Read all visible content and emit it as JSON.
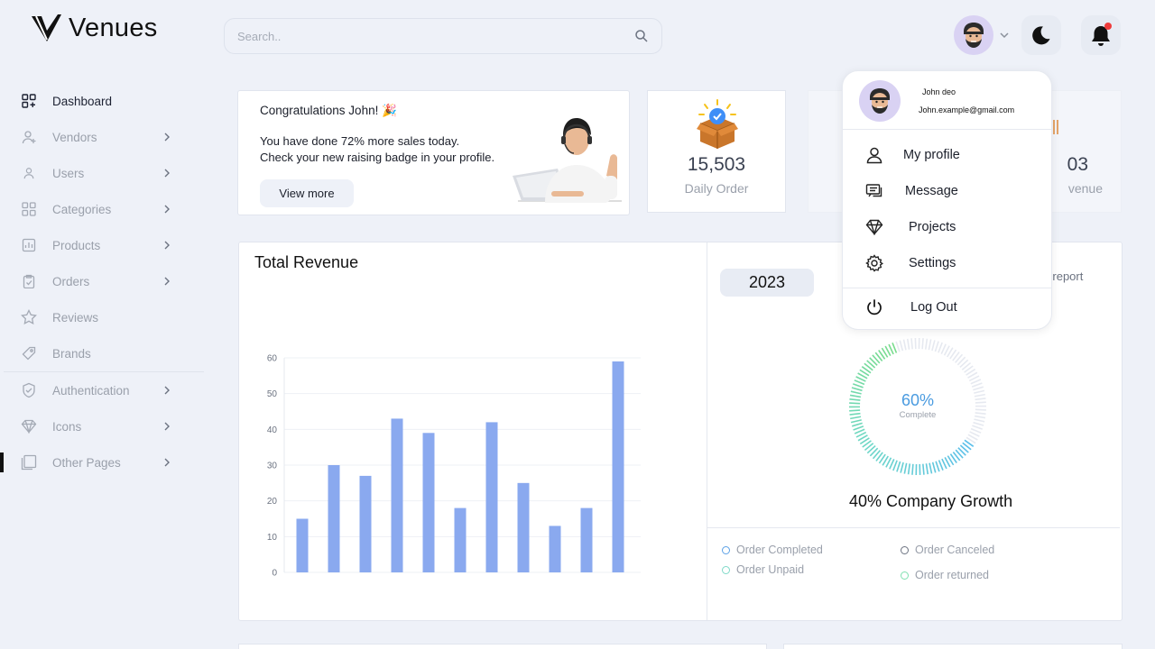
{
  "app": {
    "brand": "Venues"
  },
  "sidebar": {
    "items": [
      {
        "label": "Dashboard",
        "icon": "grid-plus-icon",
        "active": true,
        "chevron": false
      },
      {
        "label": "Vendors",
        "icon": "user-plus-icon",
        "chevron": true
      },
      {
        "label": "Users",
        "icon": "user-icon",
        "chevron": true
      },
      {
        "label": "Categories",
        "icon": "grid-icon",
        "chevron": true
      },
      {
        "label": "Products",
        "icon": "box-icon",
        "chevron": true
      },
      {
        "label": "Orders",
        "icon": "clipboard-check-icon",
        "chevron": true
      },
      {
        "label": "Reviews",
        "icon": "star-icon",
        "chevron": false
      },
      {
        "label": "Brands",
        "icon": "tag-icon",
        "chevron": false
      },
      {
        "label": "Authentication",
        "icon": "shield-check-icon",
        "chevron": true
      },
      {
        "label": "Icons",
        "icon": "diamond-icon",
        "chevron": true
      },
      {
        "label": "Other Pages",
        "icon": "pages-icon",
        "chevron": true
      }
    ]
  },
  "topbar": {
    "search_placeholder": "Search.."
  },
  "welcome": {
    "heading": "Congratulations John! 🎉",
    "line1": "You have done 72% more sales today.",
    "line2": "Check your new raising badge in your profile.",
    "button": "View more"
  },
  "stats": [
    {
      "value": "15,503",
      "label": "Daily Order",
      "icon": "box-badge-icon"
    },
    {
      "value": "03",
      "label": "venue",
      "icon": "gift-icon"
    }
  ],
  "revenue": {
    "title": "Total Revenue",
    "year": "2023",
    "report_link": "ll report",
    "gauge_percent": "60%",
    "gauge_label": "Complete",
    "gauge_value": 0.6,
    "growth": "40% Company Growth",
    "legend": [
      {
        "label": "Order Completed",
        "color": "#5aa0e6"
      },
      {
        "label": "Order Canceled",
        "color": "#6b7280"
      },
      {
        "label": "Order Unpaid",
        "color": "#7fd9c8"
      },
      {
        "label": "Order returned",
        "color": "#7fe0b0"
      }
    ]
  },
  "chart_data": {
    "type": "bar",
    "values": [
      15,
      30,
      27,
      43,
      39,
      18,
      42,
      25,
      13,
      18,
      59
    ],
    "ylim": [
      0,
      60
    ],
    "yticks": [
      "0",
      "10",
      "20",
      "30",
      "40",
      "50",
      "60"
    ],
    "color": "#8aa9ef",
    "grid": true
  },
  "dropdown": {
    "name": "John deo",
    "email": "John.example@gmail.com",
    "items": [
      {
        "label": "My profile",
        "icon": "user-icon"
      },
      {
        "label": "Message",
        "icon": "message-icon"
      },
      {
        "label": "Projects",
        "icon": "diamond-icon"
      },
      {
        "label": "Settings",
        "icon": "gear-icon"
      }
    ],
    "logout": "Log Out"
  }
}
